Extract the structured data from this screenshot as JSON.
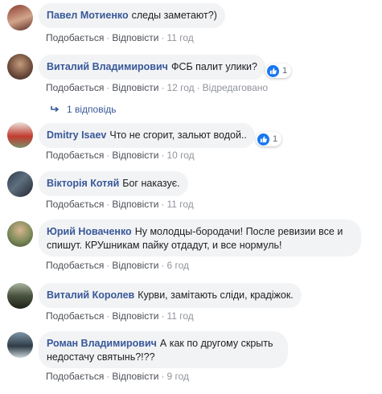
{
  "comments": [
    {
      "author": "Павел Мотиенко",
      "text": "следы заметают?)",
      "like": "Подобається",
      "reply": "Відповісти",
      "time": "11 год"
    },
    {
      "author": "Виталий Владимирович",
      "text": "ФСБ палит улики?",
      "like": "Подобається",
      "reply": "Відповісти",
      "time": "12 год",
      "edited": "Відредаговано",
      "reaction_count": "1",
      "replies_label": "1 відповідь"
    },
    {
      "author": "Dmitry Isaev",
      "text": "Что не сгорит, зальют водой..",
      "like": "Подобається",
      "reply": "Відповісти",
      "time": "10 год",
      "reaction_count": "1"
    },
    {
      "author": "Вікторія Котяй",
      "text": "Бог наказує.",
      "like": "Подобається",
      "reply": "Відповісти",
      "time": "11 год"
    },
    {
      "author": "Юрий Новаченко",
      "text": "Ну молодцы-бородачи! После ревизии все и спишут. КРУшникам пайку отдадут, и все нормуль!",
      "like": "Подобається",
      "reply": "Відповісти",
      "time": "6 год"
    },
    {
      "author": "Виталий Королев",
      "text": "Курви, замітають сліди, крадіжок.",
      "like": "Подобається",
      "reply": "Відповісти",
      "time": "11 год"
    },
    {
      "author": "Роман Владимирович",
      "text": "А как по другому скрыть недостачу святынь?!??",
      "like": "Подобається",
      "reply": "Відповісти",
      "time": "9 год"
    }
  ],
  "colors": {
    "author": "#385898",
    "bubble": "#f2f3f5",
    "like_icon": "#1877f2"
  },
  "icons": {
    "like": "like-icon",
    "reply_arrow": "reply-arrow-icon"
  }
}
